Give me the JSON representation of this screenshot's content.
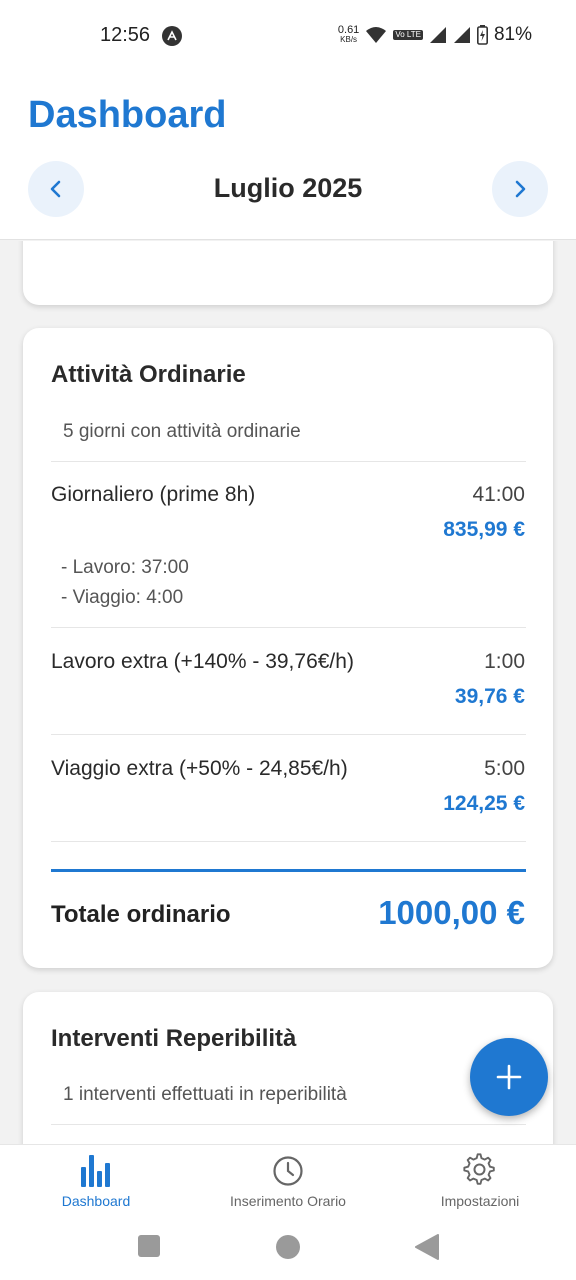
{
  "status_bar": {
    "time": "12:56",
    "net_speed_value": "0.61",
    "net_speed_unit": "KB/s",
    "volte_label": "Vo LTE",
    "battery": "81%"
  },
  "header": {
    "title": "Dashboard",
    "month": "Luglio 2025"
  },
  "ordinary": {
    "title": "Attività Ordinarie",
    "subtitle": "5 giorni con attività ordinarie",
    "rows": [
      {
        "label": "Giornaliero (prime 8h)",
        "hours": "41:00",
        "amount": "835,99 €"
      },
      {
        "label": "Lavoro extra (+140% - 39,76€/h)",
        "hours": "1:00",
        "amount": "39,76 €"
      },
      {
        "label": "Viaggio extra (+50% - 24,85€/h)",
        "hours": "5:00",
        "amount": "124,25 €"
      }
    ],
    "details": [
      "- Lavoro: 37:00",
      "- Viaggio: 4:00"
    ],
    "total_label": "Totale ordinario",
    "total_value": "1000,00 €"
  },
  "reperibilita": {
    "title": "Interventi Reperibilità",
    "subtitle": "1 interventi effettuati in reperibilità"
  },
  "bottom_nav": {
    "items": [
      {
        "label": "Dashboard",
        "icon": "bar-chart-icon",
        "active": true
      },
      {
        "label": "Inserimento Orario",
        "icon": "clock-icon",
        "active": false
      },
      {
        "label": "Impostazioni",
        "icon": "gear-icon",
        "active": false
      }
    ]
  },
  "colors": {
    "accent": "#1f78d1",
    "background": "#f2f2f2"
  }
}
